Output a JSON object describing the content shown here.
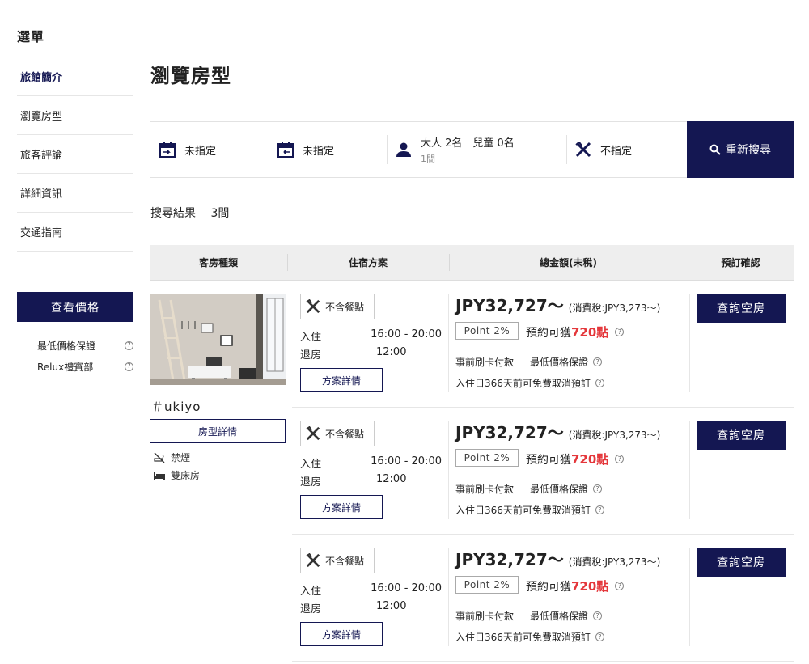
{
  "sidebar": {
    "title": "選單",
    "items": [
      {
        "label": "旅館簡介",
        "active": true
      },
      {
        "label": "瀏覽房型",
        "active": false
      },
      {
        "label": "旅客評論",
        "active": false
      },
      {
        "label": "詳細資訊",
        "active": false
      },
      {
        "label": "交通指南",
        "active": false
      }
    ],
    "price_button": "查看價格",
    "links": [
      {
        "label": "最低價格保證",
        "help": "?"
      },
      {
        "label": "Relux禮賓部",
        "help": "?"
      }
    ]
  },
  "page": {
    "title": "瀏覽房型"
  },
  "search": {
    "checkin": "未指定",
    "checkout": "未指定",
    "guests": "大人 2名　兒童 0名",
    "rooms": "1間",
    "meal": "不指定",
    "button": "重新搜尋"
  },
  "results": {
    "label": "搜尋結果",
    "count": "3間"
  },
  "table_headers": [
    "客房種類",
    "住宿方案",
    "總金額(未稅)",
    "預訂確認"
  ],
  "room": {
    "name": "＃ukiyo",
    "detail_button": "房型詳情",
    "features": [
      "禁煙",
      "雙床房"
    ]
  },
  "plans": [
    {
      "meal": "不含餐點",
      "checkin_label": "入住",
      "checkin_time": "16:00 - 20:00",
      "checkout_label": "退房",
      "checkout_time": "12:00",
      "detail_button": "方案詳情",
      "price": "JPY32,727〜",
      "tax": "(消費稅:JPY3,273〜)",
      "point_rate": "Point 2%",
      "point_prefix": "預約可獲",
      "points": "720點",
      "payment": "事前刷卡付款",
      "guarantee": "最低價格保證",
      "cancel": "入住日366天前可免費取消預訂",
      "book_button": "查詢空房"
    },
    {
      "meal": "不含餐點",
      "checkin_label": "入住",
      "checkin_time": "16:00 - 20:00",
      "checkout_label": "退房",
      "checkout_time": "12:00",
      "detail_button": "方案詳情",
      "price": "JPY32,727〜",
      "tax": "(消費稅:JPY3,273〜)",
      "point_rate": "Point 2%",
      "point_prefix": "預約可獲",
      "points": "720點",
      "payment": "事前刷卡付款",
      "guarantee": "最低價格保證",
      "cancel": "入住日366天前可免費取消預訂",
      "book_button": "查詢空房"
    },
    {
      "meal": "不含餐點",
      "checkin_label": "入住",
      "checkin_time": "16:00 - 20:00",
      "checkout_label": "退房",
      "checkout_time": "12:00",
      "detail_button": "方案詳情",
      "price": "JPY32,727〜",
      "tax": "(消費稅:JPY3,273〜)",
      "point_rate": "Point 2%",
      "point_prefix": "預約可獲",
      "points": "720點",
      "payment": "事前刷卡付款",
      "guarantee": "最低價格保證",
      "cancel": "入住日366天前可免費取消預訂",
      "book_button": "查詢空房"
    }
  ],
  "colors": {
    "brand": "#141752",
    "points": "#e4373b"
  }
}
